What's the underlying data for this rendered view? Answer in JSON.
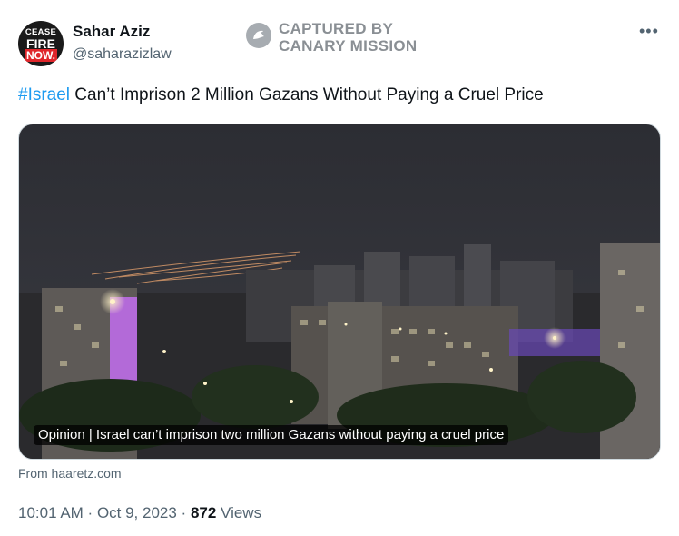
{
  "author": {
    "avatar_text": [
      "CEASE",
      "FIRE",
      "NOW."
    ],
    "name": "Sahar Aziz",
    "handle": "@saharazizlaw"
  },
  "watermark": {
    "line1": "CAPTURED BY",
    "line2": "CANARY MISSION"
  },
  "more_icon": "more-horizontal-icon",
  "tweet": {
    "hashtag": "#Israel",
    "text": " Can’t Imprison 2 Million Gazans Without Paying a Cruel Price"
  },
  "link_card": {
    "caption": "Opinion | Israel can’t imprison two million Gazans without paying a cruel price",
    "source": "From haaretz.com"
  },
  "meta": {
    "time": "10:01 AM",
    "separator": " · ",
    "date": "Oct 9, 2023",
    "views_count": "872",
    "views_label": " Views"
  },
  "colors": {
    "link_blue": "#1d9bf0",
    "text_primary": "#0f1419",
    "text_secondary": "#536471"
  }
}
